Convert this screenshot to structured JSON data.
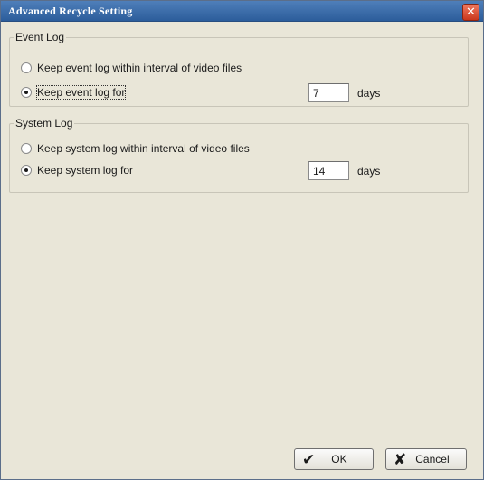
{
  "window": {
    "title": "Advanced Recycle Setting",
    "close_icon": "close-icon"
  },
  "event_log": {
    "legend": "Event Log",
    "option_interval": "Keep event log within interval of video files",
    "option_keep": "Keep event log for",
    "selected": "option_keep",
    "days_value": "7",
    "unit": "days"
  },
  "system_log": {
    "legend": "System Log",
    "option_interval": "Keep system log within interval of video files",
    "option_keep": "Keep system log for",
    "selected": "option_keep",
    "days_value": "14",
    "unit": "days"
  },
  "buttons": {
    "ok_label": "OK",
    "ok_icon": "checkmark-icon",
    "cancel_label": "Cancel",
    "cancel_icon": "x-icon"
  },
  "colors": {
    "titlebar": "#2c5d9b",
    "dialog_bg": "#e9e6d8",
    "close_button": "#c9371c"
  }
}
